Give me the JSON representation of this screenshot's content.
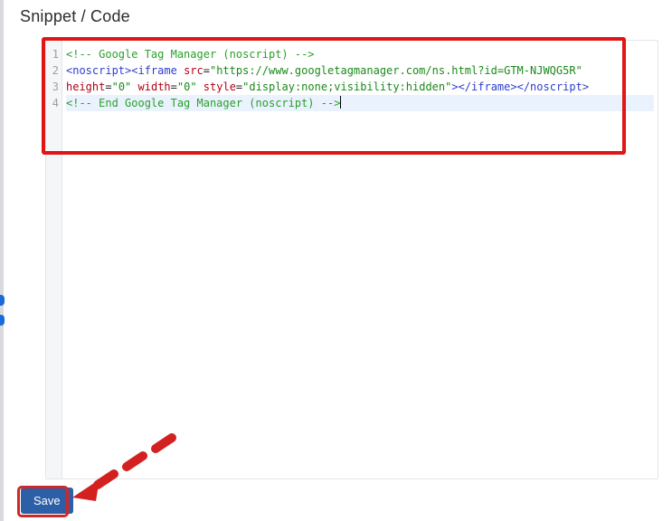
{
  "section_title": "Snippet / Code",
  "save_label": "Save",
  "line_numbers": [
    "1",
    "2",
    "3",
    "4"
  ],
  "code_lines": [
    [
      {
        "cls": "c-comment",
        "t": "<!-- Google Tag Manager (noscript) -->"
      }
    ],
    [
      {
        "cls": "c-tag",
        "t": "<noscript><iframe"
      },
      {
        "cls": "c-plain",
        "t": " "
      },
      {
        "cls": "c-attr",
        "t": "src"
      },
      {
        "cls": "c-plain",
        "t": "="
      },
      {
        "cls": "c-val",
        "t": "\"https://www.googletagmanager.com/ns.html?id=GTM-NJWQG5R\""
      }
    ],
    [
      {
        "cls": "c-attr",
        "t": "height"
      },
      {
        "cls": "c-plain",
        "t": "="
      },
      {
        "cls": "c-val",
        "t": "\"0\""
      },
      {
        "cls": "c-plain",
        "t": " "
      },
      {
        "cls": "c-attr",
        "t": "width"
      },
      {
        "cls": "c-plain",
        "t": "="
      },
      {
        "cls": "c-val",
        "t": "\"0\""
      },
      {
        "cls": "c-plain",
        "t": " "
      },
      {
        "cls": "c-attr",
        "t": "style"
      },
      {
        "cls": "c-plain",
        "t": "="
      },
      {
        "cls": "c-val",
        "t": "\"display:none;visibility:hidden\""
      },
      {
        "cls": "c-tag",
        "t": "></iframe></noscript>"
      }
    ],
    [
      {
        "cls": "c-comment",
        "t": "<!-- End Google Tag Manager (noscript) -->"
      }
    ]
  ],
  "active_line_index": 3
}
